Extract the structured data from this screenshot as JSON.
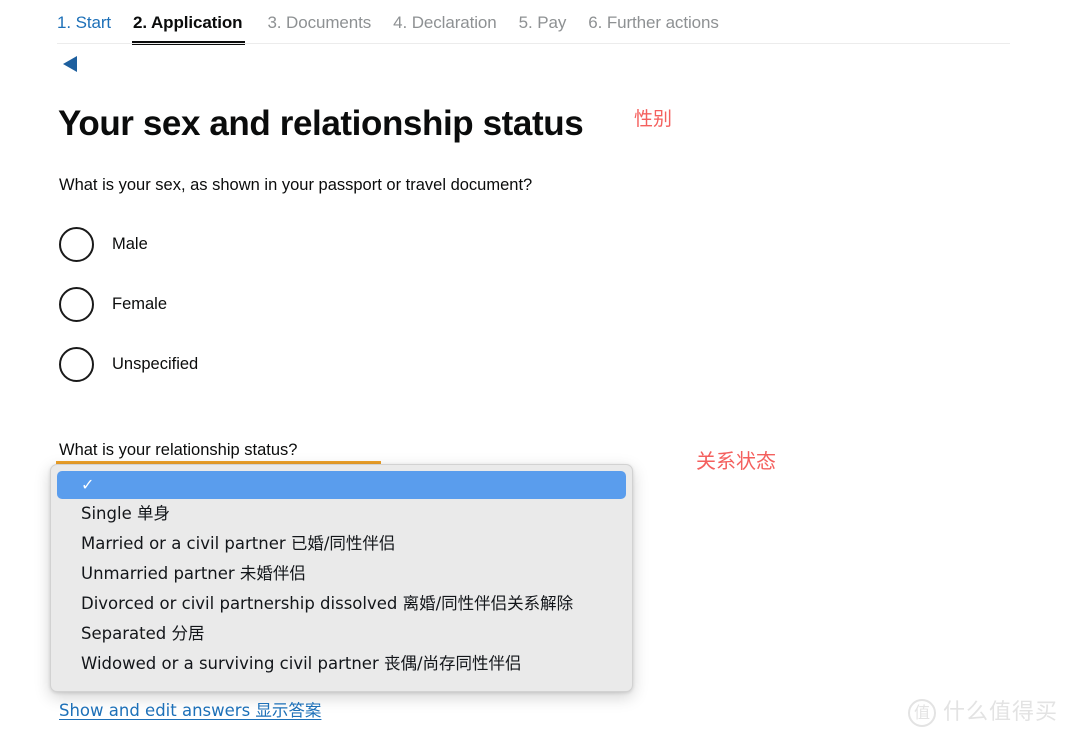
{
  "step_nav": {
    "steps": [
      {
        "label": "1. Start",
        "state": "link"
      },
      {
        "label": "2. Application",
        "state": "current"
      },
      {
        "label": "3. Documents",
        "state": "muted"
      },
      {
        "label": "4. Declaration",
        "state": "muted"
      },
      {
        "label": "5. Pay",
        "state": "muted"
      },
      {
        "label": "6. Further actions",
        "state": "muted"
      }
    ]
  },
  "back": {
    "icon": "triangle-left-icon",
    "color": "#1d5f9e"
  },
  "page": {
    "title": "Your sex and relationship status",
    "annotation_sex": "性别",
    "annotation_relationship": "关系状态"
  },
  "sex_question": {
    "label": "What is your sex, as shown in your passport or travel document?",
    "options": [
      {
        "label": "Male",
        "selected": false
      },
      {
        "label": "Female",
        "selected": false
      },
      {
        "label": "Unspecified",
        "selected": false
      }
    ]
  },
  "relationship_question": {
    "label": "What is your relationship status?",
    "selected_value": "",
    "options": [
      {
        "label": "",
        "selected": true
      },
      {
        "label": "Single 单身",
        "selected": false
      },
      {
        "label": "Married or a civil partner 已婚/同性伴侣",
        "selected": false
      },
      {
        "label": "Unmarried partner 未婚伴侣",
        "selected": false
      },
      {
        "label": "Divorced or civil partnership dissolved 离婚/同性伴侣关系解除",
        "selected": false
      },
      {
        "label": "Separated 分居",
        "selected": false
      },
      {
        "label": "Widowed or a surviving civil partner 丧偶/尚存同性伴侣",
        "selected": false
      }
    ]
  },
  "footer": {
    "edit_link": "Show and edit answers 显示答案"
  },
  "watermark": {
    "badge": "值",
    "text": "什么值得买"
  },
  "colors": {
    "link": "#1d70b8",
    "annotation_red": "#f4605e",
    "focus_orange": "#eda12a",
    "selected_blue": "#5a9ded",
    "text": "#0b0c0c",
    "muted": "#8e9193"
  }
}
